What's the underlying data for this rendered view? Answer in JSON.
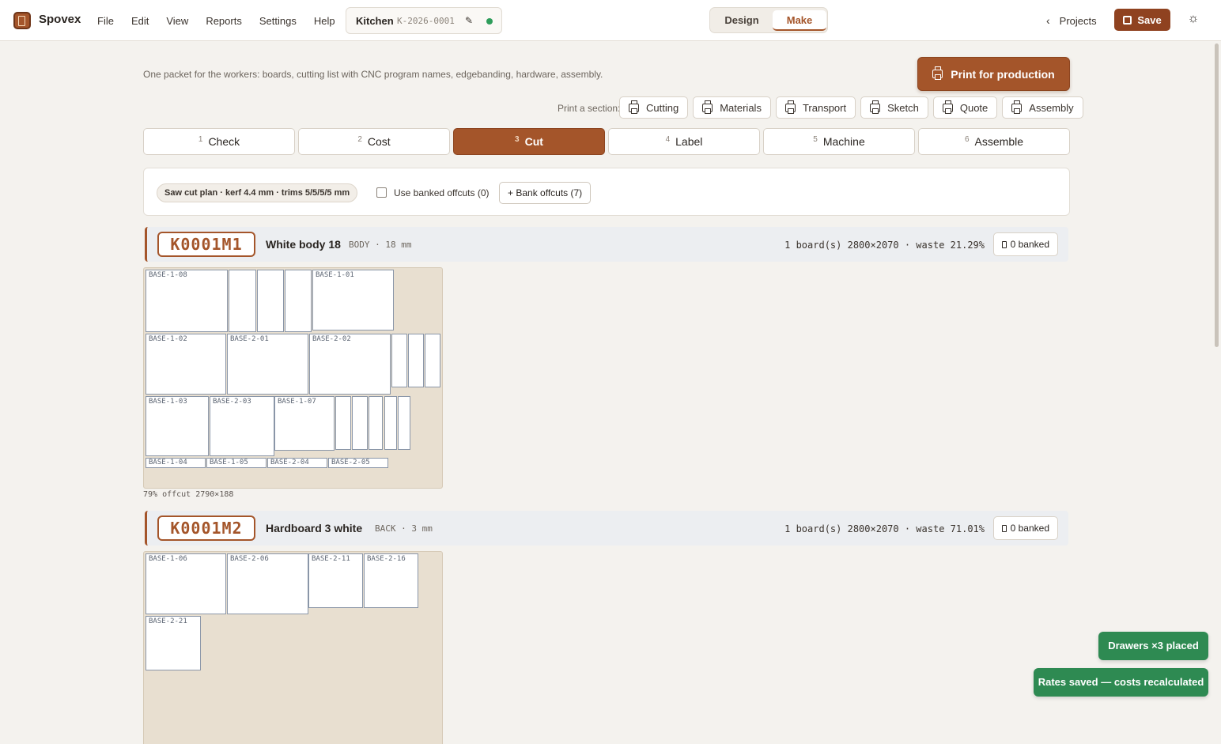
{
  "app": {
    "brand": "Spovex",
    "menu": [
      "File",
      "Edit",
      "View",
      "Reports",
      "Settings",
      "Help"
    ],
    "project_name": "Kitchen",
    "project_code": "K-2026-0001",
    "modes": [
      "Design",
      "Make"
    ],
    "active_mode": "Make",
    "projects_link": "Projects",
    "save_label": "Save"
  },
  "production": {
    "intro": "One packet for the workers: boards, cutting list with CNC program names, edgebanding, hardware, assembly.",
    "print_button": "Print for production",
    "print_section_label": "Print a section:",
    "sections": [
      "Cutting",
      "Materials",
      "Transport",
      "Sketch",
      "Quote",
      "Assembly"
    ]
  },
  "steps": [
    {
      "num": "1",
      "label": "Check"
    },
    {
      "num": "2",
      "label": "Cost"
    },
    {
      "num": "3",
      "label": "Cut"
    },
    {
      "num": "4",
      "label": "Label"
    },
    {
      "num": "5",
      "label": "Machine"
    },
    {
      "num": "6",
      "label": "Assemble"
    }
  ],
  "active_step": "Cut",
  "options": {
    "plan_pill": "Saw cut plan · kerf 4.4 mm · trims 5/5/5/5 mm",
    "use_banked_label": "Use banked offcuts (0)",
    "use_banked_checked": false,
    "bank_button": "+ Bank offcuts (7)"
  },
  "materials": [
    {
      "code": "K0001M1",
      "name": "White body 18",
      "type": "BODY · 18 mm",
      "stats": "1 board(s) 2800×2070 · waste 21.29%",
      "banked": "0 banked",
      "parts": [
        {
          "label": "BASE-1-08"
        },
        {
          "label": ""
        },
        {
          "label": ""
        },
        {
          "label": ""
        },
        {
          "label": "BASE-1-01"
        },
        {
          "label": "BASE-1-02"
        },
        {
          "label": "BASE-2-01"
        },
        {
          "label": "BASE-2-02"
        },
        {
          "label": ""
        },
        {
          "label": ""
        },
        {
          "label": ""
        },
        {
          "label": "BASE-1-03"
        },
        {
          "label": "BASE-2-03"
        },
        {
          "label": "BASE-1-07"
        },
        {
          "label": ""
        },
        {
          "label": ""
        },
        {
          "label": ""
        },
        {
          "label": ""
        },
        {
          "label": ""
        },
        {
          "label": "BASE-1-04"
        },
        {
          "label": "BASE-1-05"
        },
        {
          "label": "BASE-2-04"
        },
        {
          "label": "BASE-2-05"
        }
      ],
      "offcut_note": "79% offcut 2790×188"
    },
    {
      "code": "K0001M2",
      "name": "Hardboard 3 white",
      "type": "BACK · 3 mm",
      "stats": "1 board(s) 2800×2070 · waste 71.01%",
      "banked": "0 banked",
      "parts": [
        {
          "label": "BASE-1-06"
        },
        {
          "label": "BASE-2-06"
        },
        {
          "label": "BASE-2-11"
        },
        {
          "label": "BASE-2-16"
        },
        {
          "label": "BASE-2-21"
        }
      ]
    }
  ],
  "toasts": [
    "Drawers ×3 placed",
    "Rates saved — costs recalculated"
  ],
  "colors": {
    "accent": "#a4552a",
    "accent_dark": "#8f4220",
    "success": "#2e8a52",
    "board": "#e8dfd0",
    "background": "#f4f2ee"
  },
  "icons": [
    "logo-icon",
    "pencil-icon",
    "status-dot-icon",
    "chevron-left-icon",
    "floppy-icon",
    "sun-icon",
    "printer-icon",
    "bin-icon"
  ]
}
